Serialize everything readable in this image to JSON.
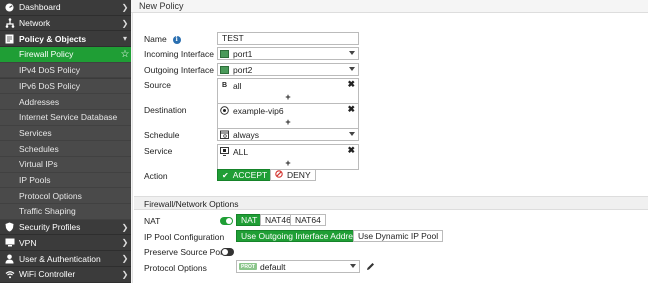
{
  "sidebar": {
    "items": [
      {
        "label": "Dashboard",
        "icon": "dashboard-icon"
      },
      {
        "label": "Network",
        "icon": "network-icon"
      },
      {
        "label": "Policy & Objects",
        "icon": "policy-icon"
      },
      {
        "label": "Firewall Policy"
      },
      {
        "label": "IPv4 DoS Policy"
      },
      {
        "label": "IPv6 DoS Policy"
      },
      {
        "label": "Addresses"
      },
      {
        "label": "Internet Service Database"
      },
      {
        "label": "Services"
      },
      {
        "label": "Schedules"
      },
      {
        "label": "Virtual IPs"
      },
      {
        "label": "IP Pools"
      },
      {
        "label": "Protocol Options"
      },
      {
        "label": "Traffic Shaping"
      },
      {
        "label": "Security Profiles",
        "icon": "security-icon"
      },
      {
        "label": "VPN",
        "icon": "vpn-icon"
      },
      {
        "label": "User & Authentication",
        "icon": "user-icon"
      },
      {
        "label": "WiFi Controller",
        "icon": "wifi-icon"
      }
    ]
  },
  "page": {
    "title": "New Policy"
  },
  "form": {
    "name": {
      "label": "Name",
      "value": "TEST"
    },
    "incoming": {
      "label": "Incoming Interface",
      "value": "port1"
    },
    "outgoing": {
      "label": "Outgoing Interface",
      "value": "port2"
    },
    "source": {
      "label": "Source",
      "value": "all",
      "icon_text": "B"
    },
    "destination": {
      "label": "Destination",
      "value": "example-vip6"
    },
    "schedule": {
      "label": "Schedule",
      "value": "always"
    },
    "service": {
      "label": "Service",
      "value": "ALL"
    },
    "action": {
      "label": "Action",
      "accept": "ACCEPT",
      "deny": "DENY"
    },
    "plus": "+",
    "remove": "✖"
  },
  "firewall": {
    "section_title": "Firewall/Network Options",
    "nat": {
      "label": "NAT",
      "options": [
        "NAT",
        "NAT46",
        "NAT64"
      ]
    },
    "ip_pool": {
      "label": "IP Pool Configuration",
      "option_active": "Use Outgoing Interface Address",
      "option_other": "Use Dynamic IP Pool"
    },
    "preserve": {
      "label": "Preserve Source Port"
    },
    "protocol": {
      "label": "Protocol Options",
      "badge": "PROT",
      "value": "default"
    }
  },
  "colors": {
    "accent": "#1f9e35",
    "sidebar": "#3b3b3b"
  }
}
